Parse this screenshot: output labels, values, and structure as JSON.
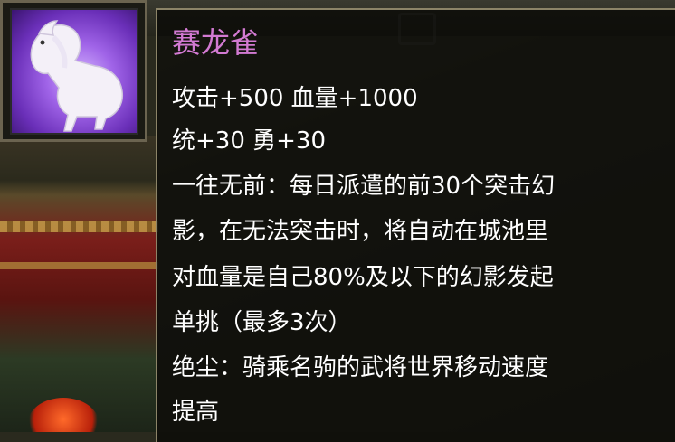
{
  "item": {
    "name": "赛龙雀",
    "name_color": "#d27ad2",
    "portrait_icon": "white-horse-icon",
    "stats_line1": "攻击+500 血量+1000",
    "stats_line2": "统+30 勇+30",
    "skill1_line1": "一往无前：每日派遣的前30个突击幻",
    "skill1_line2": "影，在无法突击时，将自动在城池里",
    "skill1_line3": "对血量是自己80%及以下的幻影发起",
    "skill1_line4": "单挑（最多3次）",
    "skill2_line1": "绝尘：骑乘名驹的武将世界移动速度",
    "skill2_line2": "提高"
  }
}
